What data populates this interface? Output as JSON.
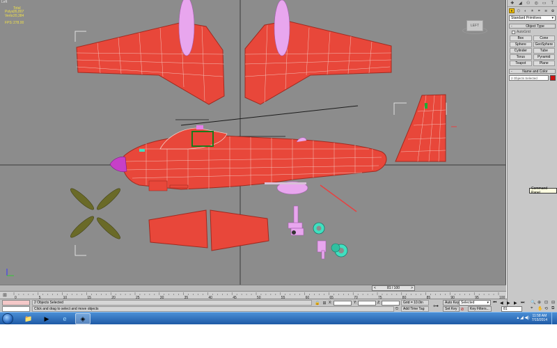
{
  "viewport": {
    "label": "Left",
    "stats": [
      {
        "k": "",
        "v": "Total"
      },
      {
        "k": "Polys:",
        "v": "26,807"
      },
      {
        "k": "Verts:",
        "v": "20,384"
      }
    ],
    "fps": {
      "k": "FPS:",
      "v": "278.00"
    },
    "viewcube_label": "LEFT",
    "colors": {
      "background": "#8c8c8c",
      "mesh": "#e8473a",
      "wire": "#f2d0c8",
      "accent": "#e47fe8"
    }
  },
  "command_panel": {
    "tabs": [
      "✚",
      "◢",
      "⚇",
      "◎",
      "▭",
      "T"
    ],
    "subtabs": [
      "●",
      "⬡",
      "◐",
      "☀",
      "⌗",
      "≋",
      "✿"
    ],
    "category": "Standard Primitives",
    "object_type_header": "Object Type",
    "autogrid": "AutoGrid",
    "buttons": [
      "Box",
      "Cone",
      "Sphere",
      "GeoSphere",
      "Cylinder",
      "Tube",
      "Torus",
      "Pyramid",
      "Teapot",
      "Plane"
    ],
    "name_color_header": "Name and Color",
    "name_value": "2 Objects Selected",
    "tooltip": "Command Panel",
    "sign": "-"
  },
  "timeline": {
    "slider_text": "81 / 100",
    "ticks": [
      "0",
      "5",
      "10",
      "15",
      "20",
      "25",
      "30",
      "35",
      "40",
      "45",
      "50",
      "55",
      "60",
      "65",
      "70",
      "75",
      "80",
      "85",
      "90",
      "95",
      "100"
    ]
  },
  "status": {
    "selection": "2 Objects Selected",
    "prompt": "Click and drag to select and move objects",
    "x_label": "X:",
    "y_label": "Y:",
    "z_label": "Z:",
    "grid": "Grid = 10.0in",
    "add_time_tag": "Add Time Tag",
    "auto_key": "Auto Key",
    "selected_option": "Selected",
    "set_key": "Set Key",
    "key_filters": "Key Filters...",
    "frame": "81"
  },
  "taskbar": {
    "time": "11:58 AM",
    "date": "7/15/2014",
    "tray": "▴ ◢ ◀)"
  }
}
